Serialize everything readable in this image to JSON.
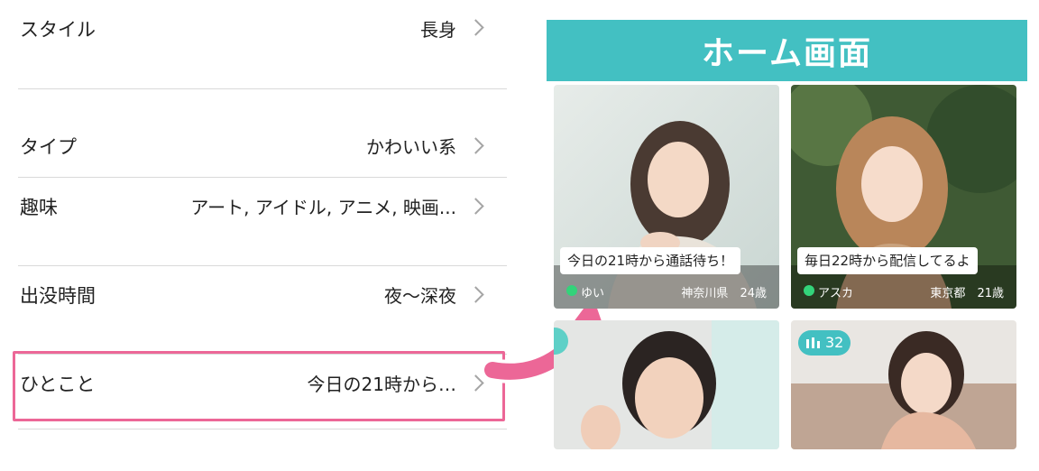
{
  "settings": {
    "rows": [
      {
        "label": "スタイル",
        "value": "長身"
      },
      {
        "label": "タイプ",
        "value": "かわいい系"
      },
      {
        "label": "趣味",
        "value": "アート, アイドル, アニメ, 映画..."
      },
      {
        "label": "出没時間",
        "value": "夜〜深夜"
      },
      {
        "label": "ひとこと",
        "value": "今日の21時から…"
      }
    ]
  },
  "home": {
    "title": "ホーム画面",
    "cards": [
      {
        "message": "今日の21時から通話待ち！",
        "name": "ゆい",
        "location": "神奈川県",
        "age": "24歳"
      },
      {
        "message": "毎日22時から配信してるよ",
        "name": "アスカ",
        "location": "東京都",
        "age": "21歳"
      },
      {
        "badge": ""
      },
      {
        "badge": "32"
      }
    ]
  },
  "colors": {
    "accent": "#43c0c2",
    "highlight": "#ec6797",
    "online": "#33d37a"
  }
}
